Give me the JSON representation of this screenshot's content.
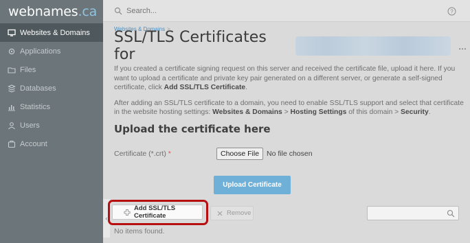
{
  "brand": {
    "name_part1": "webnames",
    "name_part2": ".ca",
    "accent_color": "#8fc3e0"
  },
  "sidebar": {
    "items": [
      {
        "label": "Websites & Domains",
        "icon": "monitor-icon",
        "active": true
      },
      {
        "label": "Applications",
        "icon": "gear-icon",
        "active": false
      },
      {
        "label": "Files",
        "icon": "folder-icon",
        "active": false
      },
      {
        "label": "Databases",
        "icon": "database-icon",
        "active": false
      },
      {
        "label": "Statistics",
        "icon": "bar-chart-icon",
        "active": false
      },
      {
        "label": "Users",
        "icon": "user-icon",
        "active": false
      },
      {
        "label": "Account",
        "icon": "account-icon",
        "active": false
      }
    ]
  },
  "topbar": {
    "search_placeholder": "Search...",
    "help_icon": "help-icon"
  },
  "breadcrumb": {
    "item": "Websites & Domains",
    "separator": ">"
  },
  "page": {
    "title": "SSL/TLS Certificates for",
    "more_label": "...",
    "intro_part1": "If you created a certificate signing request on this server and received the certificate file, upload it here. If you want to upload a certificate and private key pair generated on a different server, or generate a self-signed certificate, click ",
    "intro_bold": "Add SSL/TLS Certificate",
    "intro_end": ".",
    "info_part1": "After adding an SSL/TLS certificate to a domain, you need to enable SSL/TLS support and select that certificate in the website hosting settings: ",
    "info_bold1": "Websites & Domains",
    "info_gt1": " > ",
    "info_bold2": "Hosting Settings",
    "info_mid": " of this domain > ",
    "info_bold3": "Security",
    "info_end": "."
  },
  "upload_section": {
    "heading": "Upload the certificate here",
    "cert_label": "Certificate (*.crt)",
    "required_mark": "*",
    "choose_file_label": "Choose File",
    "file_status": "No file chosen",
    "upload_button": "Upload Certificate"
  },
  "list_toolbar": {
    "add_button": "Add SSL/TLS Certificate",
    "remove_button": "Remove",
    "collapse_glyph": "‹",
    "empty_message": "No items found."
  },
  "colors": {
    "highlight": "#b70f0f",
    "primary_button": "#6fb0d9",
    "link": "#4a8fc2"
  }
}
